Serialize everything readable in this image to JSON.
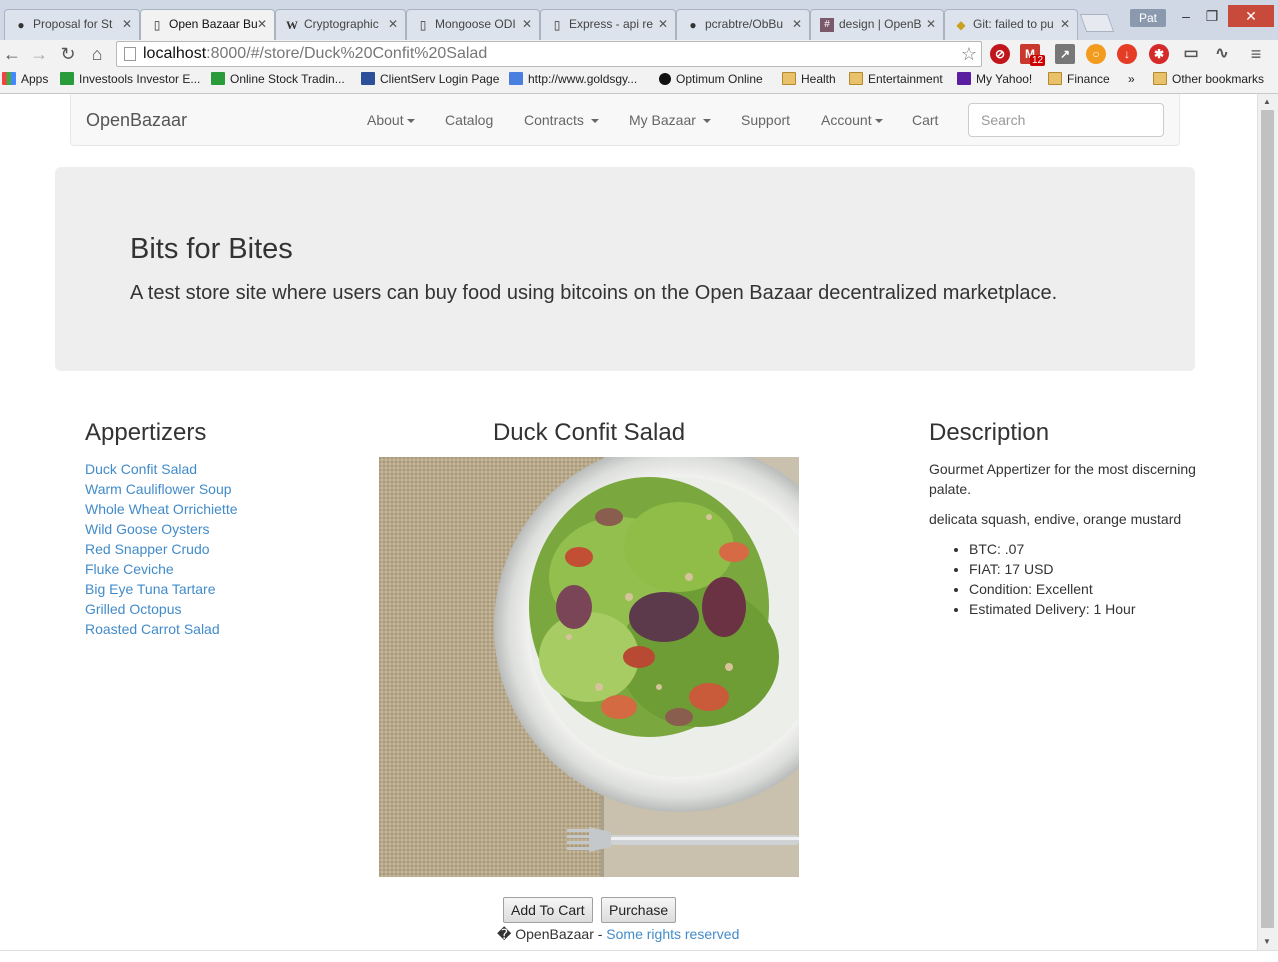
{
  "browser": {
    "tabs": [
      {
        "title": "Proposal for St",
        "icon": "github-icon"
      },
      {
        "title": "Open Bazaar Bu",
        "icon": "page-icon",
        "active": true
      },
      {
        "title": "Cryptographic",
        "icon": "wikipedia-icon"
      },
      {
        "title": "Mongoose ODI",
        "icon": "page-icon"
      },
      {
        "title": "Express - api re",
        "icon": "page-icon"
      },
      {
        "title": "pcrabtre/ObBu",
        "icon": "github-icon"
      },
      {
        "title": "design | OpenB",
        "icon": "hash-icon"
      },
      {
        "title": "Git: failed to pu",
        "icon": "git-icon"
      }
    ],
    "user": "Pat",
    "url_host": "localhost",
    "url_path": ":8000/#/store/Duck%20Confit%20Salad",
    "bookmarks": [
      "Apps",
      "Investools Investor E...",
      "Online Stock Tradin...",
      "ClientServ Login Page",
      "http://www.goldsgy...",
      "Optimum Online",
      "Health",
      "Entertainment",
      "My Yahoo!",
      "Finance",
      "»",
      "Other bookmarks"
    ],
    "gmail_count": "12"
  },
  "navbar": {
    "brand": "OpenBazaar",
    "links": [
      "About",
      "Catalog",
      "Contracts",
      "My Bazaar",
      "Support",
      "Account",
      "Cart"
    ],
    "search_placeholder": "Search"
  },
  "jumbotron": {
    "title": "Bits for Bites",
    "subtitle": "A test store site where users can buy food using bitcoins on the Open Bazaar decentralized marketplace."
  },
  "menu": {
    "heading": "Appertizers",
    "items": [
      "Duck Confit Salad",
      "Warm Cauliflower Soup",
      "Whole Wheat Orrichiette",
      "Wild Goose Oysters",
      "Red Snapper Crudo",
      "Fluke Ceviche",
      "Big Eye Tuna Tartare",
      "Grilled Octopus",
      "Roasted Carrot Salad"
    ]
  },
  "product": {
    "title": "Duck Confit Salad",
    "add_to_cart": "Add To Cart",
    "purchase": "Purchase"
  },
  "description": {
    "heading": "Description",
    "text": "Gourmet Appertizer for the most discerning palate.",
    "ingredients": "delicata squash, endive, orange mustard",
    "details": [
      "BTC: .07",
      "FIAT: 17 USD",
      "Condition: Excellent",
      "Estimated Delivery: 1 Hour"
    ]
  },
  "footer": {
    "prefix": "� OpenBazaar - ",
    "link": "Some rights reserved"
  }
}
